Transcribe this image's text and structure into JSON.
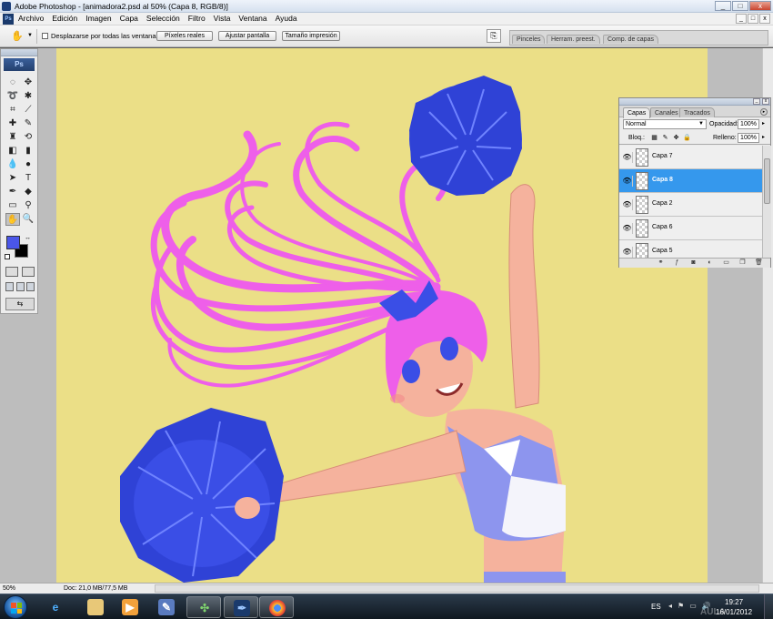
{
  "window": {
    "title": "Adobe Photoshop - [animadora2.psd al 50% (Capa 8, RGB/8)]",
    "controls": [
      "_",
      "□",
      "x"
    ]
  },
  "menu": {
    "logo": "Ps",
    "items": [
      "Archivo",
      "Edición",
      "Imagen",
      "Capa",
      "Selección",
      "Filtro",
      "Vista",
      "Ventana",
      "Ayuda"
    ],
    "doc_controls": [
      "_",
      "□",
      "x"
    ]
  },
  "options": {
    "tool_icon": "hand-icon",
    "scroll_all_label": "Desplazarse por todas las ventanas",
    "buttons": [
      "Píxeles reales",
      "Ajustar pantalla",
      "Tamaño impresión"
    ],
    "well_tabs": [
      "Pinceles",
      "Herram. preest.",
      "Comp. de capas"
    ]
  },
  "tools": {
    "logo": "Ps",
    "icons": [
      "marquee",
      "move",
      "lasso",
      "magic-wand",
      "crop",
      "slice",
      "healing",
      "brush",
      "stamp",
      "history-brush",
      "eraser",
      "gradient",
      "blur",
      "dodge",
      "path-select",
      "type",
      "pen",
      "shape",
      "notes",
      "eyedropper",
      "hand",
      "zoom"
    ],
    "foreground": "#4a56e8",
    "background": "#000000"
  },
  "layers_panel": {
    "tabs": [
      "Capas",
      "Canales",
      "Tracados"
    ],
    "blend_mode": "Normal",
    "opacity_label": "Opacidad:",
    "opacity_value": "100%",
    "lock_label": "Bloq.:",
    "fill_label": "Relleno:",
    "fill_value": "100%",
    "layers": [
      {
        "name": "Capa 7",
        "active": false
      },
      {
        "name": "Capa 8",
        "active": true
      },
      {
        "name": "Capa 2",
        "active": false
      },
      {
        "name": "Capa 6",
        "active": false
      },
      {
        "name": "Capa 5",
        "active": false
      }
    ],
    "bottom_icons": [
      "link-icon",
      "fx-icon",
      "mask-icon",
      "adjustment-icon",
      "group-icon",
      "new-layer-icon",
      "trash-icon"
    ]
  },
  "status": {
    "zoom": "50%",
    "doc": "Doc: 21,0 MB/77,5 MB"
  },
  "taskbar": {
    "lang": "ES",
    "time": "19:27",
    "date": "16/01/2012",
    "watermark": "AULA"
  },
  "colors": {
    "canvas": "#ebdf87",
    "hair": "#ee5fe9",
    "pompom": "#3a4ee6",
    "skin": "#f5b29d",
    "uniform": "#8d95ee",
    "selection": "#3598ed"
  }
}
